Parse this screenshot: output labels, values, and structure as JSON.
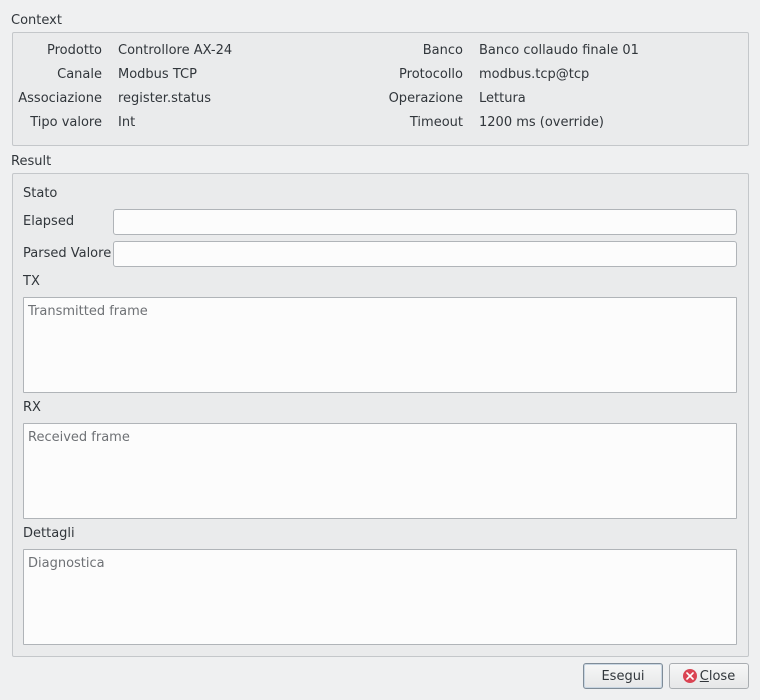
{
  "context": {
    "title": "Context",
    "left": [
      {
        "label": "Prodotto",
        "value": "Controllore AX-24"
      },
      {
        "label": "Canale",
        "value": "Modbus TCP"
      },
      {
        "label": "Associazione",
        "value": "register.status"
      },
      {
        "label": "Tipo valore",
        "value": "Int"
      }
    ],
    "right": [
      {
        "label": "Banco",
        "value": "Banco collaudo finale 01"
      },
      {
        "label": "Protocollo",
        "value": "modbus.tcp@tcp"
      },
      {
        "label": "Operazione",
        "value": "Lettura"
      },
      {
        "label": "Timeout",
        "value": "1200 ms (override)"
      }
    ]
  },
  "result": {
    "title": "Result",
    "stato_label": "Stato",
    "elapsed_label": "Elapsed",
    "elapsed_value": "",
    "parsed_label": "Parsed Valore",
    "parsed_value": "",
    "tx_label": "TX",
    "tx_placeholder": "Transmitted frame",
    "rx_label": "RX",
    "rx_placeholder": "Received frame",
    "dettagli_label": "Dettagli",
    "dettagli_placeholder": "Diagnostica"
  },
  "buttons": {
    "run_label": "Esegui",
    "close_mnemonic": "C",
    "close_rest": "lose"
  },
  "icons": {
    "close": "close-circle-icon"
  },
  "colors": {
    "close_icon": "#da4453"
  }
}
